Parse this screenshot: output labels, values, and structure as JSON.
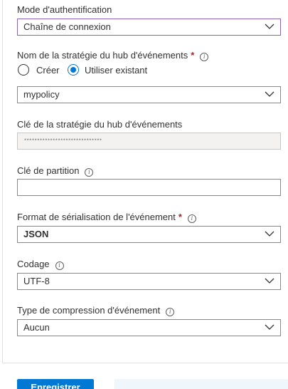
{
  "auth": {
    "label": "Mode d'authentification",
    "value": "Chaîne de connexion"
  },
  "policy_name": {
    "label": "Nom de la stratégie du hub d'événements",
    "required_mark": "*",
    "info_icon": "info-icon",
    "options": [
      "Créer",
      "Utiliser existant"
    ],
    "selected_option": "Utiliser existant",
    "value": "mypolicy"
  },
  "policy_key": {
    "label": "Clé de la stratégie du hub d'événements",
    "masked_value": "••••••••••••••••••••••••••••••"
  },
  "partition_key": {
    "label": "Clé de partition",
    "value": ""
  },
  "serialization": {
    "label": "Format de sérialisation de l'événement",
    "required_mark": "*",
    "value": "JSON"
  },
  "encoding": {
    "label": "Codage",
    "value": "UTF-8"
  },
  "compression": {
    "label": "Type de compression d'événement",
    "value": "Aucun"
  },
  "footer": {
    "save_label": "Enregistrer"
  },
  "colors": {
    "accent": "#0078d4",
    "focus_border": "#8764b8",
    "required": "#a4262c"
  }
}
